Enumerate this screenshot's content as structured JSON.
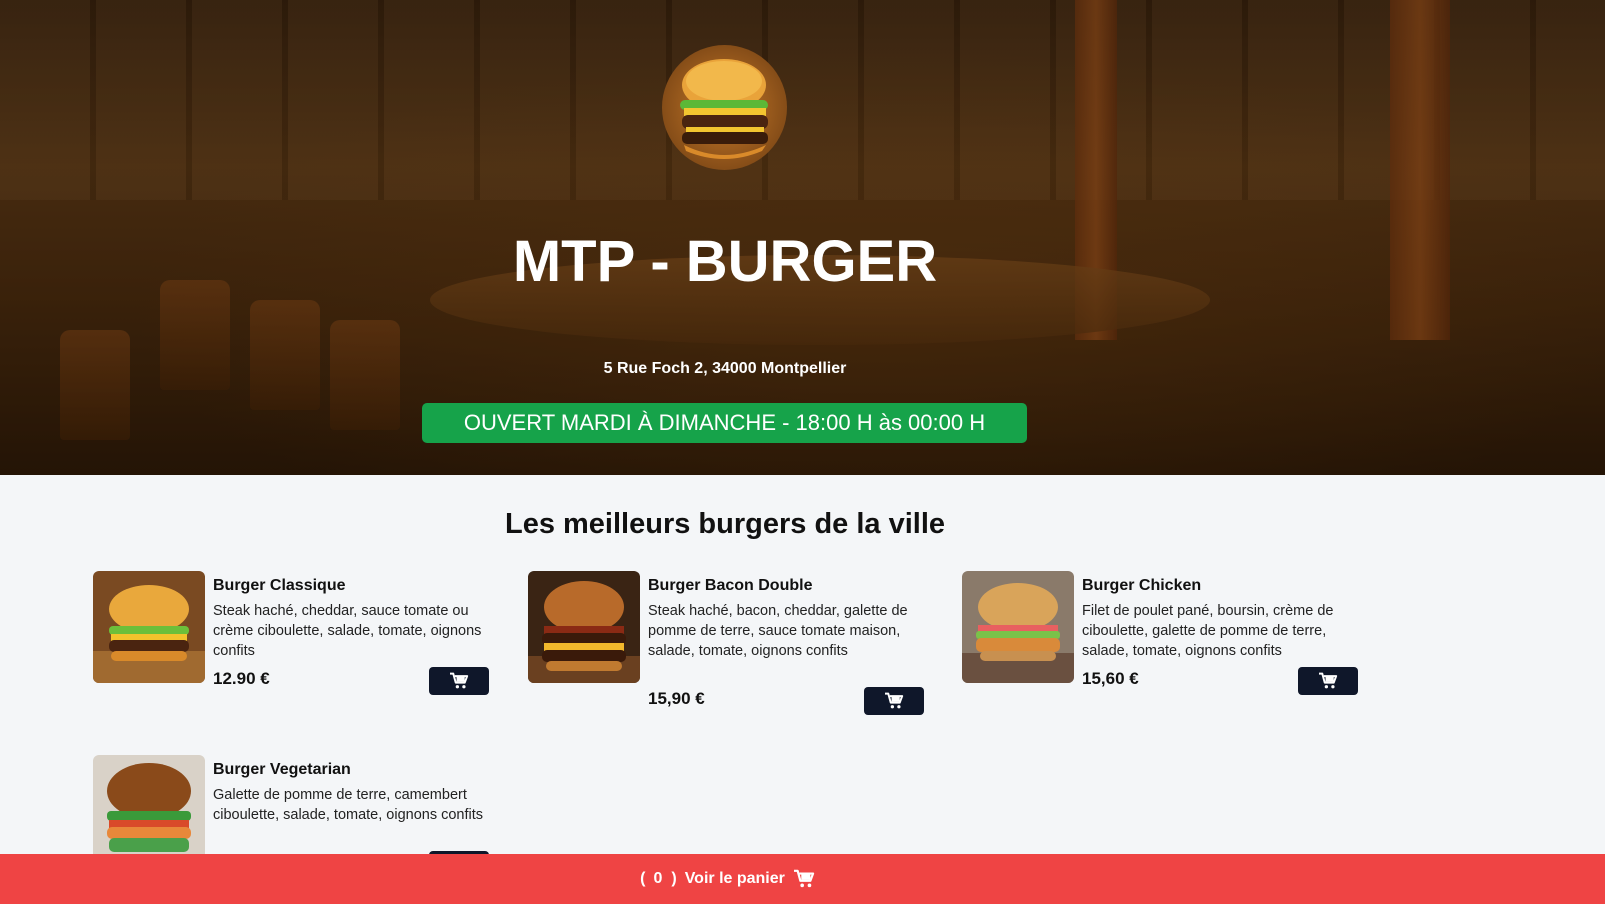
{
  "restaurant": {
    "name": "MTP - BURGER",
    "address": "5 Rue Foch 2, 34000 Montpellier",
    "hours": "OUVERT MARDI À DIMANCHE - 18:00 H às 00:00 H"
  },
  "menu": {
    "title": "Les meilleurs burgers de la ville",
    "items": [
      {
        "name": "Burger Classique",
        "description": "Steak haché, cheddar, sauce tomate ou crème ciboulette, salade, tomate, oignons confits",
        "price": "12.90 €"
      },
      {
        "name": "Burger Bacon Double",
        "description": "Steak haché, bacon, cheddar, galette de pomme de terre, sauce tomate maison, salade, tomate, oignons confits",
        "price": "15,90 €"
      },
      {
        "name": "Burger Chicken",
        "description": "Filet de poulet pané, boursin, crème de ciboulette, galette de pomme de terre, salade, tomate, oignons confits",
        "price": "15,60 €"
      },
      {
        "name": "Burger Vegetarian",
        "description": "Galette de pomme de terre, camembert ciboulette, salade, tomate, oignons confits",
        "price": ""
      }
    ]
  },
  "cart": {
    "open_paren": "(",
    "count": "0",
    "close_paren": ")",
    "label": "Voir le panier"
  },
  "icons": {
    "cart": "shopping-cart-icon",
    "logo": "burger-logo"
  },
  "colors": {
    "hours_badge": "#16a34a",
    "cart_bar": "#ef4444",
    "cart_button": "#0f172a"
  }
}
